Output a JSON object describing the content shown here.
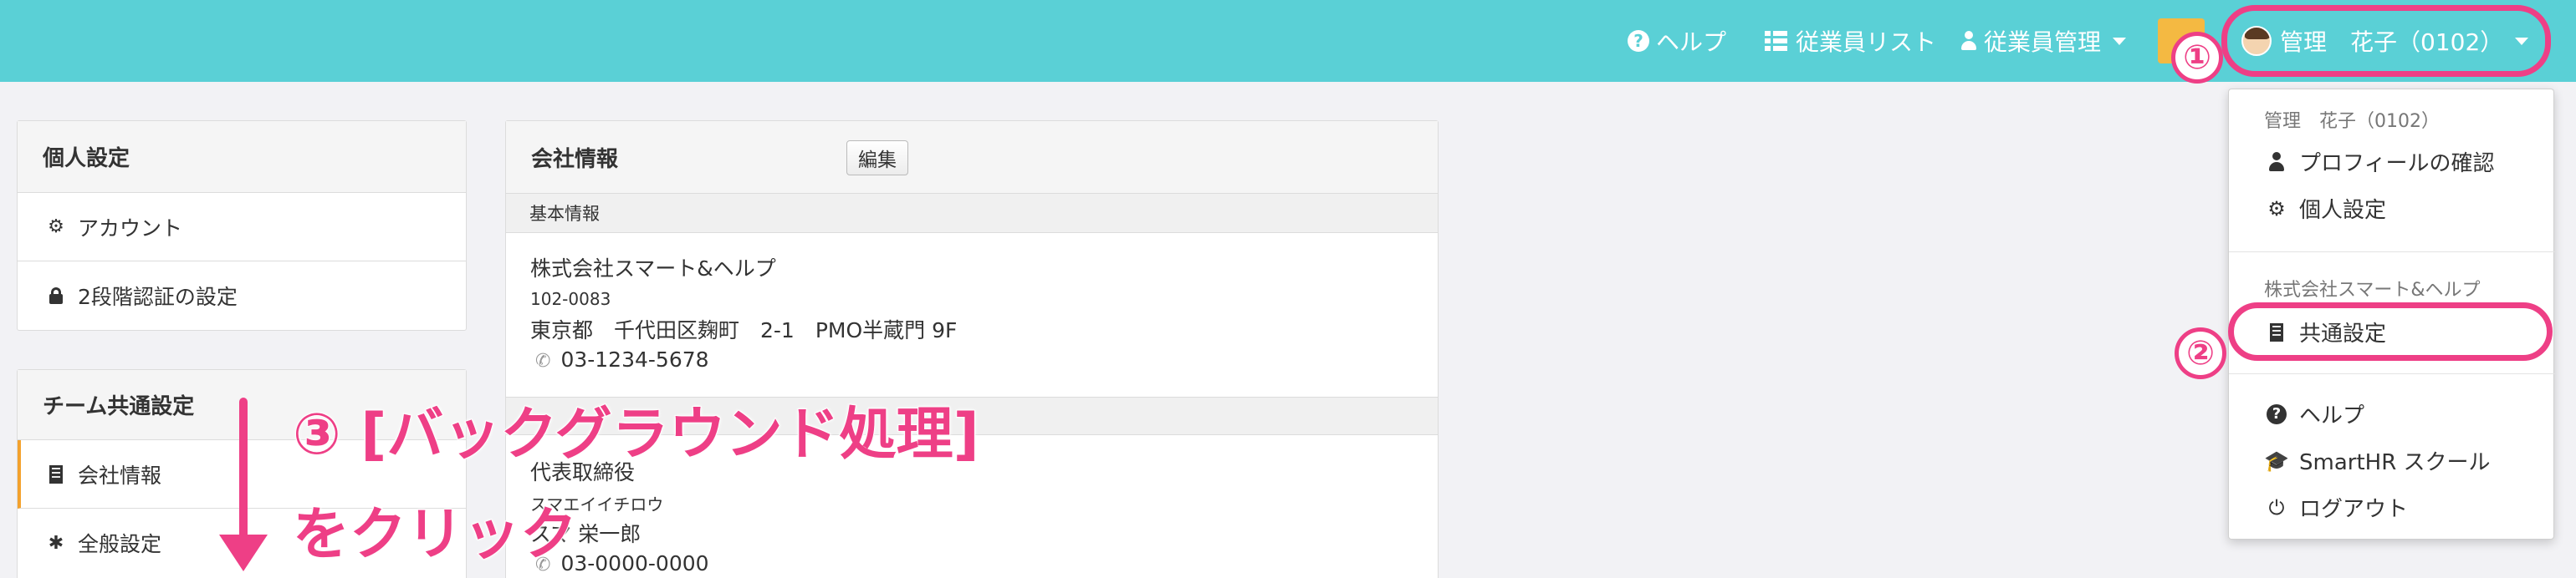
{
  "topbar": {
    "help": "ヘルプ",
    "employee_list": "従業員リスト",
    "employee_mgmt": "従業員管理",
    "user_name": "管理　花子（0102）"
  },
  "personal_panel": {
    "title": "個人設定",
    "items": [
      "アカウント",
      "2段階認証の設定"
    ]
  },
  "team_panel": {
    "title": "チーム共通設定",
    "items": [
      "会社情報",
      "全般設定"
    ]
  },
  "company": {
    "title": "会社情報",
    "edit_label": "編集",
    "section_basic": "基本情報",
    "name": "株式会社スマート&ヘルプ",
    "postal": "102-0083",
    "address": "東京都　千代田区麹町　2-1　PMO半蔵門 9F",
    "phone": "03-1234-5678",
    "rep_title": "代表取締役",
    "rep_kana": "スマエイイチロウ",
    "rep_name": "スマ 栄一郎",
    "rep_phone": "03-0000-0000"
  },
  "dropdown": {
    "user_label": "管理　花子（0102）",
    "profile": "プロフィールの確認",
    "personal_settings": "個人設定",
    "company_label": "株式会社スマート&ヘルプ",
    "common_settings": "共通設定",
    "help": "ヘルプ",
    "school": "SmartHR スクール",
    "logout": "ログアウト"
  },
  "annotations": {
    "step1": "①",
    "step2": "②",
    "callout_line1": "③ [バックグラウンド処理]",
    "callout_line2": "をクリック"
  },
  "colors": {
    "topbar": "#5ad0d6",
    "accent": "#ee3f86",
    "active_border": "#f4a22d"
  }
}
